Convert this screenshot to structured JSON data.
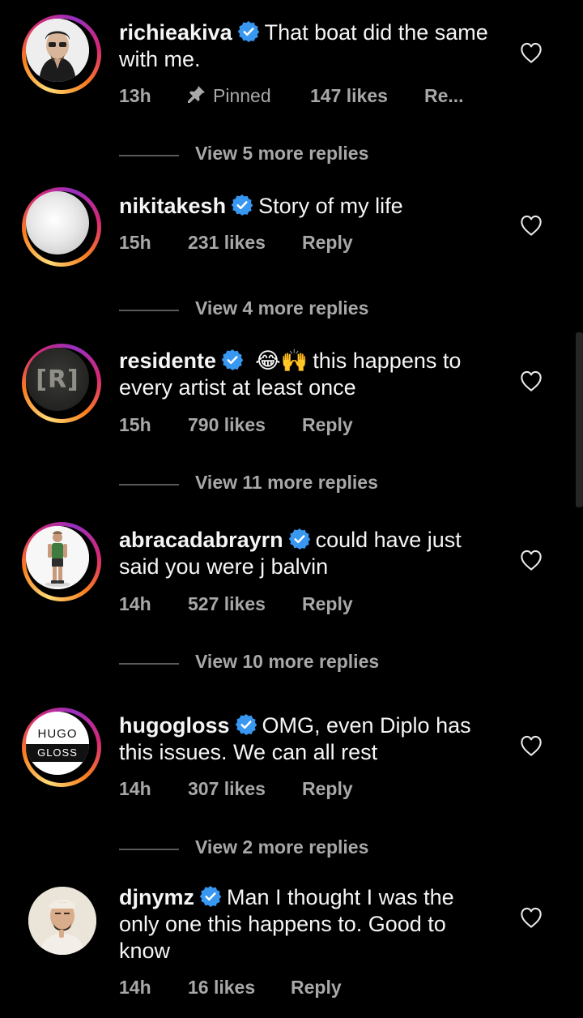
{
  "comments": [
    {
      "username": "richieakiva",
      "text": "That boat did the same with me.",
      "time": "13h",
      "pinned": "Pinned",
      "likes": "147 likes",
      "reply": "Re...",
      "view_more": "View 5 more replies"
    },
    {
      "username": "nikitakesh",
      "text": "Story of my life",
      "time": "15h",
      "likes": "231 likes",
      "reply": "Reply",
      "view_more": "View 4 more replies"
    },
    {
      "username": "residente",
      "emoji": "😂🙌",
      "text": "this happens to every artist at least once",
      "time": "15h",
      "likes": "790 likes",
      "reply": "Reply",
      "view_more": "View 11 more replies"
    },
    {
      "username": "abracadabrayrn",
      "text": "could have just said you were j balvin",
      "time": "14h",
      "likes": "527 likes",
      "reply": "Reply",
      "view_more": "View 10 more replies"
    },
    {
      "username": "hugogloss",
      "avatar_text_top": "HUGO",
      "avatar_text_bottom": "GLOSS",
      "text": "OMG, even Diplo has this issues. We can all rest",
      "time": "14h",
      "likes": "307 likes",
      "reply": "Reply",
      "view_more": "View 2 more replies"
    },
    {
      "username": "djnymz",
      "text": "Man I thought I was the only one this happens to. Good to know",
      "time": "14h",
      "likes": "16 likes",
      "reply": "Reply"
    }
  ],
  "residente_avatar_label": "[R]",
  "colors": {
    "background": "#000000",
    "text": "#f5f5f5",
    "secondary": "#a8a8a8",
    "verified": "#3897f0"
  }
}
